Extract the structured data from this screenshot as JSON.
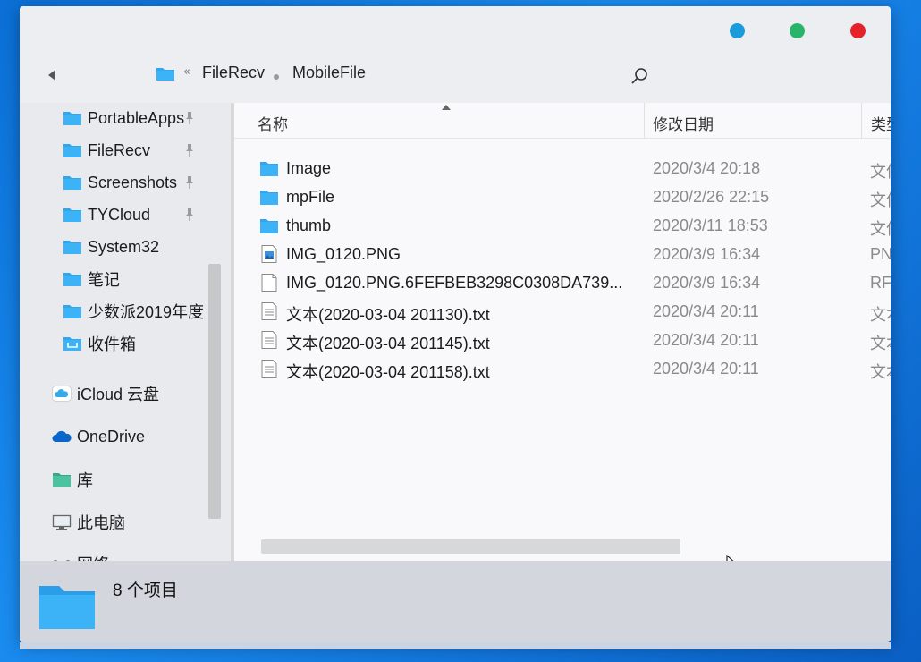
{
  "window": {
    "controls": [
      "minimize",
      "maximize",
      "close"
    ]
  },
  "address_bar": {
    "overflow_glyph": "«",
    "path": [
      "FileRecv",
      "MobileFile"
    ]
  },
  "sidebar": {
    "quick_access": [
      {
        "label": "PortableApps",
        "pinned": true
      },
      {
        "label": "FileRecv",
        "pinned": true
      },
      {
        "label": "Screenshots",
        "pinned": true
      },
      {
        "label": "TYCloud",
        "pinned": true
      },
      {
        "label": "System32",
        "pinned": false
      },
      {
        "label": "笔记",
        "pinned": false
      },
      {
        "label": "少数派2019年度",
        "pinned": false
      },
      {
        "label": "收件箱",
        "pinned": false
      }
    ],
    "icloud": "iCloud 云盘",
    "onedrive": "OneDrive",
    "library": "库",
    "this_pc": "此电脑",
    "network": "网络"
  },
  "columns": {
    "name": "名称",
    "date": "修改日期",
    "type": "类型"
  },
  "files": [
    {
      "name": "Image",
      "date": "2020/3/4 20:18",
      "type": "文件夹",
      "icon": "folder-icon"
    },
    {
      "name": "mpFile",
      "date": "2020/2/26 22:15",
      "type": "文件夹",
      "icon": "folder-icon"
    },
    {
      "name": "thumb",
      "date": "2020/3/11 18:53",
      "type": "文件夹",
      "icon": "folder-icon"
    },
    {
      "name": "IMG_0120.PNG",
      "date": "2020/3/9 16:34",
      "type": "PNG",
      "icon": "image-file-icon"
    },
    {
      "name": "IMG_0120.PNG.6FEFBEB3298C0308DA739...",
      "date": "2020/3/9 16:34",
      "type": "RF",
      "icon": "blank-file-icon"
    },
    {
      "name": "文本(2020-03-04 201130).txt",
      "date": "2020/3/4 20:11",
      "type": "文本",
      "icon": "text-file-icon"
    },
    {
      "name": "文本(2020-03-04 201145).txt",
      "date": "2020/3/4 20:11",
      "type": "文本",
      "icon": "text-file-icon"
    },
    {
      "name": "文本(2020-03-04 201158).txt",
      "date": "2020/3/4 20:11",
      "type": "文本",
      "icon": "text-file-icon"
    }
  ],
  "status": {
    "item_count": "8 个项目"
  },
  "colors": {
    "folder": "#2ea6f0",
    "accent_blue": "#1a9bdc",
    "green": "#2ab36a",
    "red": "#e5222a"
  }
}
